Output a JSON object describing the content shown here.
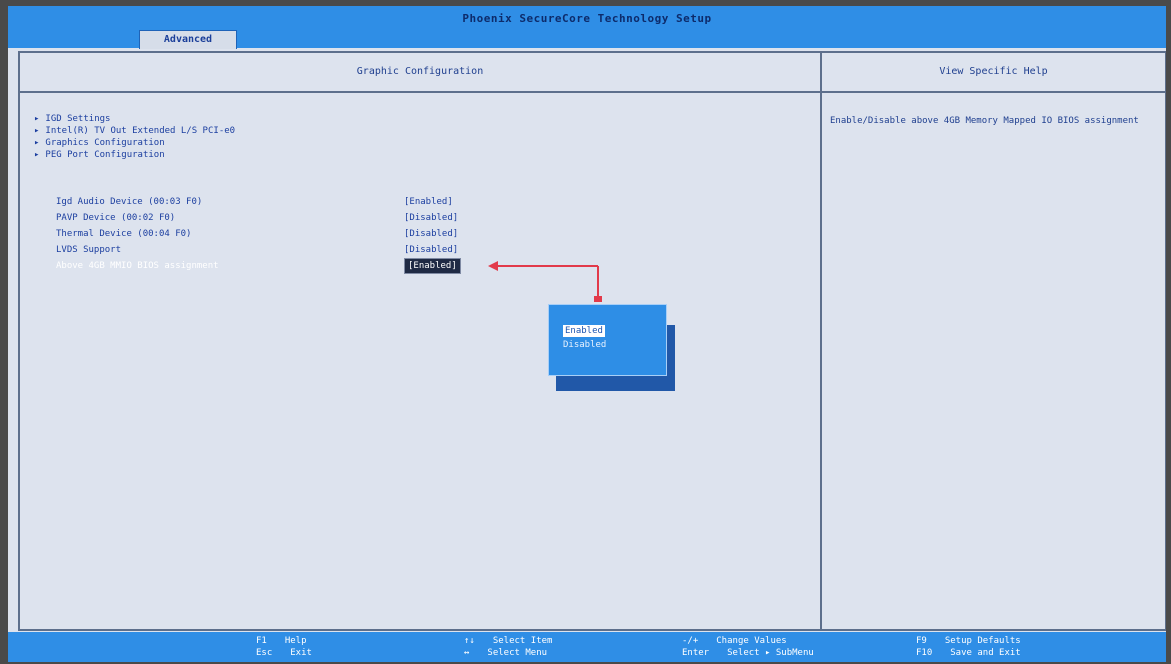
{
  "header": {
    "title": "Phoenix SecureCore Technology Setup",
    "tabs": [
      {
        "label": "Advanced"
      }
    ]
  },
  "main_panel": {
    "title": "Graphic Configuration",
    "submenus": [
      {
        "label": "IGD Settings"
      },
      {
        "label": "Intel(R) TV Out Extended L/S PCI-e0"
      },
      {
        "label": "Graphics Configuration"
      },
      {
        "label": "PEG Port Configuration"
      }
    ],
    "options": [
      {
        "label": "Igd Audio Device (00:03 F0)",
        "value": "[Enabled]"
      },
      {
        "label": "PAVP Device (00:02 F0)",
        "value": "[Disabled]"
      },
      {
        "label": "Thermal Device (00:04 F0)",
        "value": "[Disabled]"
      },
      {
        "label": "LVDS Support",
        "value": "[Disabled]"
      },
      {
        "label": "Above 4GB MMIO BIOS assignment",
        "value": "[Enabled]"
      }
    ]
  },
  "popup": {
    "options": [
      {
        "label": "Enabled"
      },
      {
        "label": "Disabled"
      }
    ]
  },
  "help_panel": {
    "title": "View Specific Help",
    "text": "Enable/Disable above 4GB Memory Mapped IO BIOS assignment"
  },
  "footer": {
    "rows": [
      [
        {
          "key": "F1",
          "desc": "Help"
        },
        {
          "key": "↑↓",
          "desc": "Select Item"
        },
        {
          "key": "-/+",
          "desc": "Change Values"
        },
        {
          "key": "F9",
          "desc": "Setup Defaults"
        }
      ],
      [
        {
          "key": "Esc",
          "desc": "Exit"
        },
        {
          "key": "↔",
          "desc": "Select Menu"
        },
        {
          "key": "Enter",
          "desc": "Select ▸ SubMenu"
        },
        {
          "key": "F10",
          "desc": "Save and Exit"
        }
      ]
    ]
  },
  "colors": {
    "title_bar": "#2f8ee6",
    "panel_bg": "#dde3ee",
    "text_blue": "#1c3fa0",
    "popup_bg": "#2e8ee6",
    "connector_red": "#e23a4a"
  }
}
